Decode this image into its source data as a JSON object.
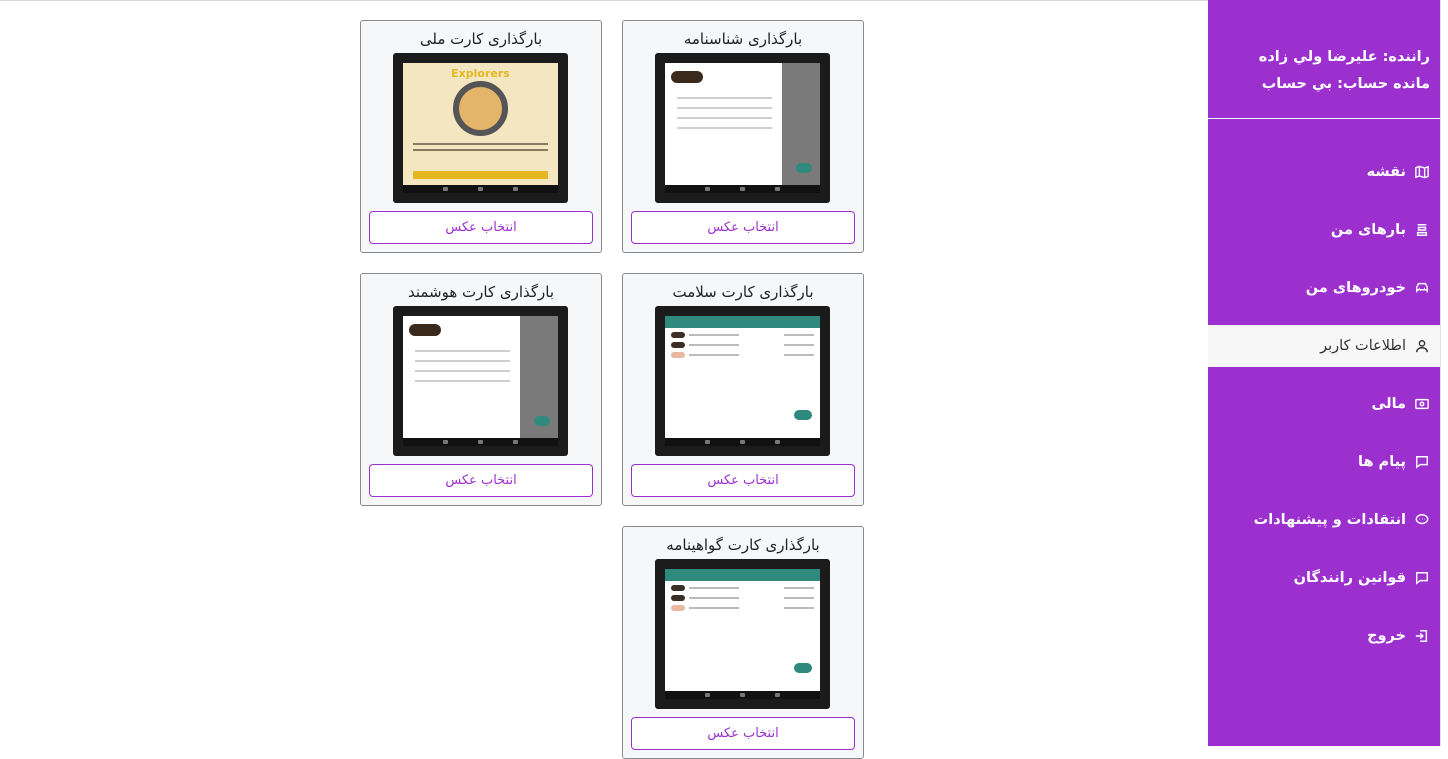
{
  "sidebar": {
    "driver_line": "راننده: عليرضا ولي زاده",
    "balance_line": "مانده حساب: بي حساب",
    "items": [
      {
        "label": "نقشه",
        "icon": "map-icon"
      },
      {
        "label": "بارهای من",
        "icon": "cargo-icon"
      },
      {
        "label": "خودروهای من",
        "icon": "car-icon"
      },
      {
        "label": "اطلاعات کاربر",
        "icon": "user-icon"
      },
      {
        "label": "مالی",
        "icon": "money-icon"
      },
      {
        "label": "پیام ها",
        "icon": "message-icon"
      },
      {
        "label": "انتقادات و پیشنهادات",
        "icon": "feedback-icon"
      },
      {
        "label": "قوانین رانندگان",
        "icon": "rules-icon"
      },
      {
        "label": "خروج",
        "icon": "logout-icon"
      }
    ],
    "active_item": "اطلاعات کاربر"
  },
  "cards": [
    {
      "title": "بارگذاری شناسنامه",
      "button": "انتخاب عکس"
    },
    {
      "title": "بارگذاری کارت ملی",
      "button": "انتخاب عکس"
    },
    {
      "title": "بارگذاری کارت سلامت",
      "button": "انتخاب عکس"
    },
    {
      "title": "بارگذاری کارت هوشمند",
      "button": "انتخاب عکس"
    },
    {
      "title": "بارگذاری کارت گواهینامه",
      "button": "انتخاب عکس"
    }
  ],
  "preview_texts": {
    "explorers_heading": "Explorers"
  },
  "colors": {
    "accent": "#9b30cf",
    "card_bg": "#f6f7f9",
    "active_item_bg": "#f7f7f8"
  }
}
